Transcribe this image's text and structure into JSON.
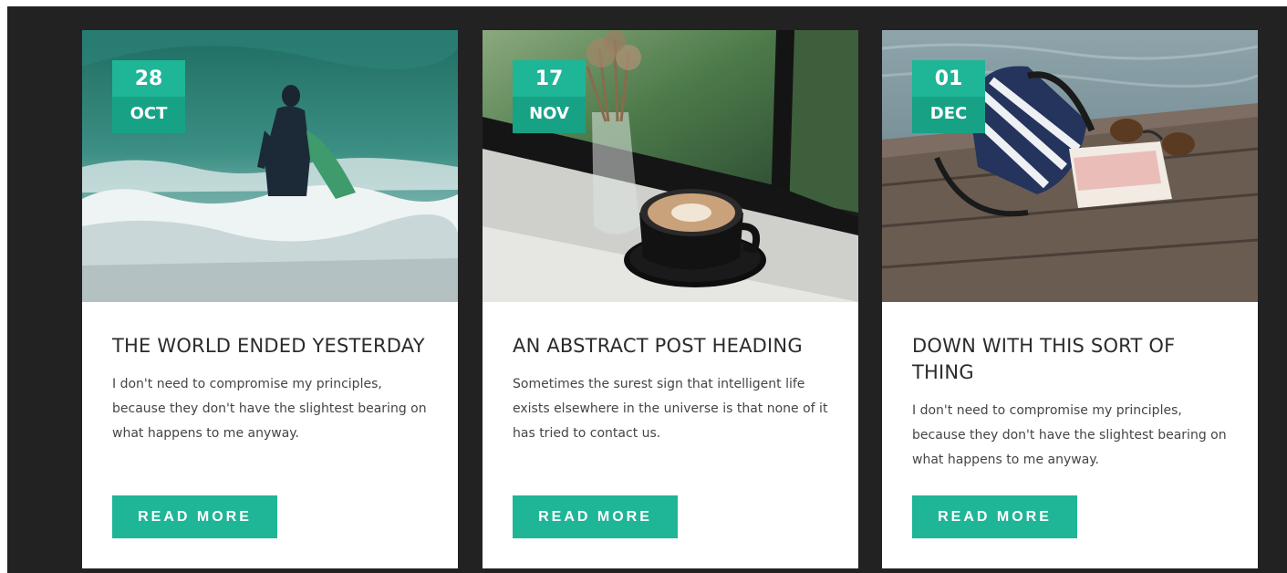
{
  "colors": {
    "accent": "#1fb597",
    "accent_dark": "#17a286",
    "background": "#222222",
    "card": "#ffffff",
    "title": "#2b2b2b",
    "text": "#454545"
  },
  "posts": [
    {
      "image": "surfer-in-waves-photo",
      "date": {
        "day": "28",
        "month": "OCT"
      },
      "title": "THE WORLD ENDED YESTERDAY",
      "excerpt": "I don't need to compromise my principles, because they don't have the slightest bearing on what happens to me anyway.",
      "button_label": "READ MORE"
    },
    {
      "image": "coffee-cup-by-window-photo",
      "date": {
        "day": "17",
        "month": "NOV"
      },
      "title": "AN ABSTRACT POST HEADING",
      "excerpt": "Sometimes the surest sign that intelligent life exists elsewhere in the universe is that none of it has tried to contact us.",
      "button_label": "READ MORE"
    },
    {
      "image": "bag-book-sunglasses-on-dock-photo",
      "date": {
        "day": "01",
        "month": "DEC"
      },
      "title": "DOWN WITH THIS SORT OF THING",
      "excerpt": "I don't need to compromise my principles, because they don't have the slightest bearing on what happens to me anyway.",
      "button_label": "READ MORE"
    }
  ]
}
